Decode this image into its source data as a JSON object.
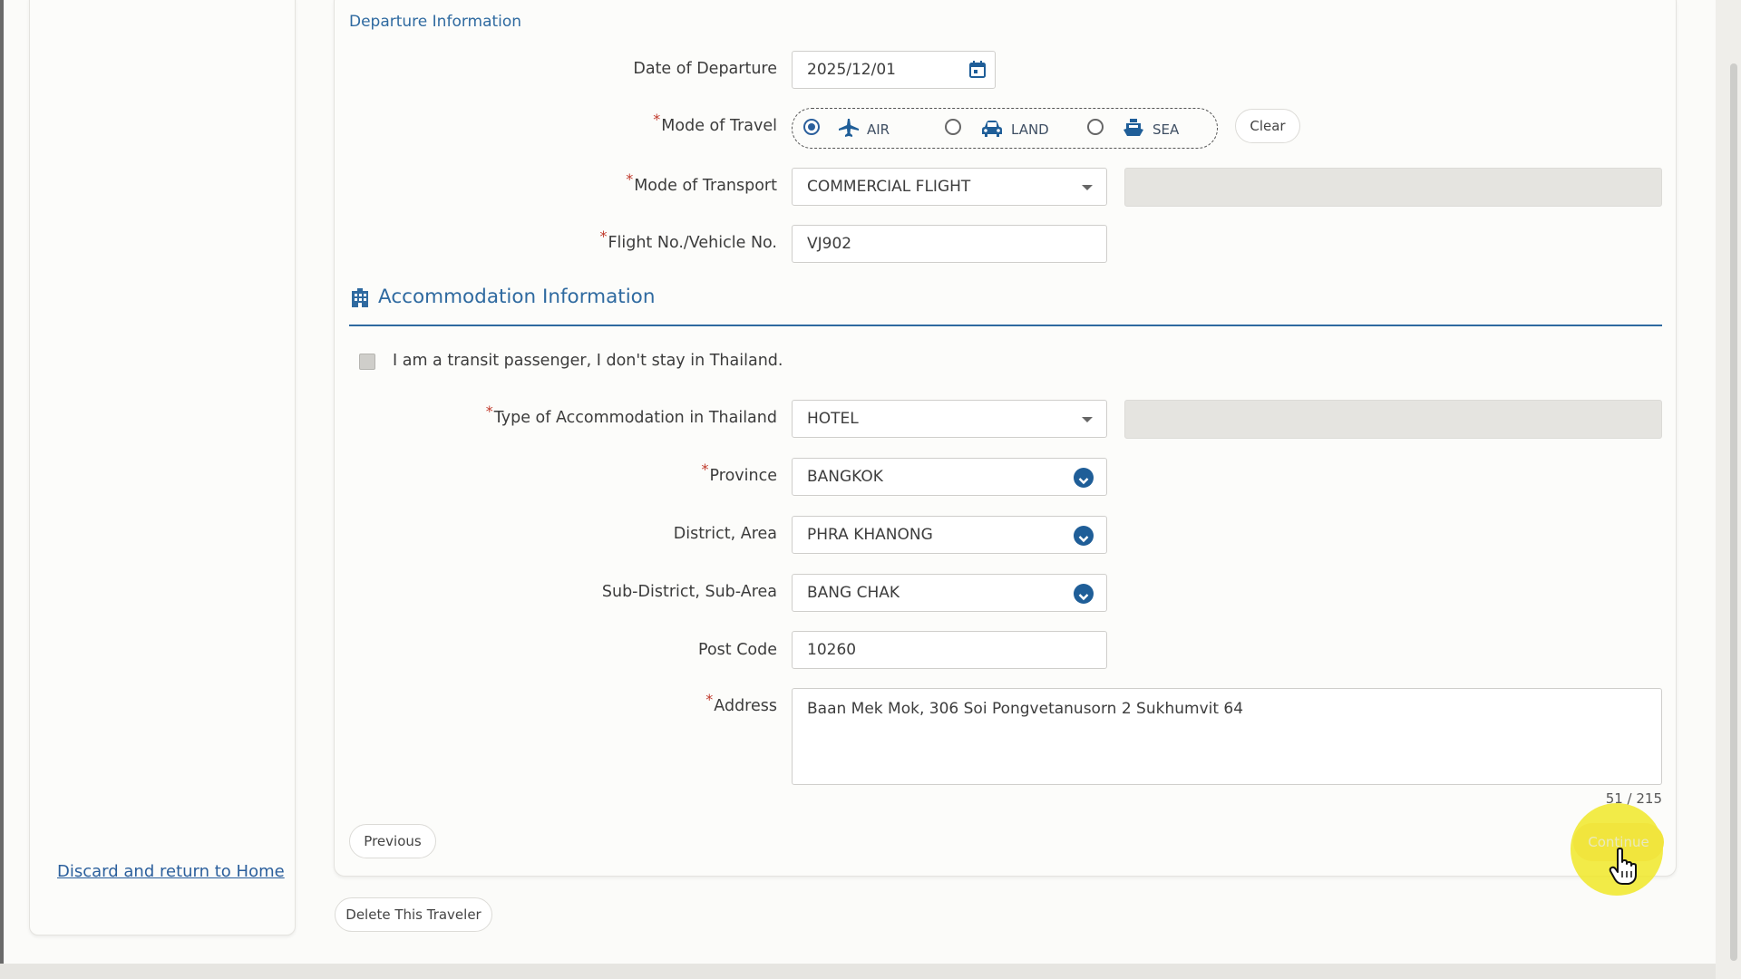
{
  "departure": {
    "section_title": "Departure Information",
    "date_label": "Date of Departure",
    "date_value": "2025/12/01",
    "mode_travel_label": "Mode of Travel",
    "options": [
      {
        "label": "AIR",
        "icon": "plane-icon",
        "selected": true
      },
      {
        "label": "LAND",
        "icon": "car-icon",
        "selected": false
      },
      {
        "label": "SEA",
        "icon": "ship-icon",
        "selected": false
      }
    ],
    "clear_label": "Clear",
    "mode_transport_label": "Mode of Transport",
    "mode_transport_value": "COMMERCIAL FLIGHT",
    "flight_label": "Flight No./Vehicle No.",
    "flight_value": "VJ902"
  },
  "accommodation": {
    "title": "Accommodation Information",
    "transit_label": "I am a transit passenger, I don't stay in Thailand.",
    "transit_checked": false,
    "type_label": "Type of Accommodation in Thailand",
    "type_value": "HOTEL",
    "province_label": "Province",
    "province_value": "BANGKOK",
    "district_label": "District, Area",
    "district_value": "PHRA KHANONG",
    "subdistrict_label": "Sub-District, Sub-Area",
    "subdistrict_value": "BANG CHAK",
    "postcode_label": "Post Code",
    "postcode_value": "10260",
    "address_label": "Address",
    "address_value": "Baan Mek Mok, 306 Soi Pongvetanusorn 2 Sukhumvit 64",
    "char_counter": "51 / 215"
  },
  "actions": {
    "previous_label": "Previous",
    "continue_label": "Continue",
    "delete_label": "Delete This Traveler",
    "discard_label": "Discard and return to Home"
  },
  "colors": {
    "accent": "#2f6aa0",
    "required": "#c0392b",
    "highlight": "#f0e828"
  }
}
